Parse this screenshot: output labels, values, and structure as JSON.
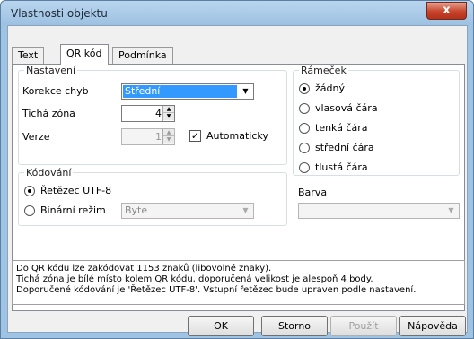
{
  "window": {
    "title": "Vlastnosti objektu",
    "close_glyph": "x"
  },
  "tabs": [
    {
      "label": "Text"
    },
    {
      "label": "QR kód"
    },
    {
      "label": "Podmínka"
    }
  ],
  "active_tab": 1,
  "settings": {
    "group_label": "Nastavení",
    "error_correction_label": "Korekce chyb",
    "error_correction_value": "Střední",
    "quiet_zone_label": "Tichá zóna",
    "quiet_zone_value": "4",
    "version_label": "Verze",
    "version_value": "1",
    "auto_label": "Automaticky",
    "auto_checked": "✓"
  },
  "encoding": {
    "group_label": "Kódování",
    "utf8_label": "Řetězec UTF-8",
    "binary_label": "Binární režim",
    "binary_select_value": "Byte"
  },
  "frame": {
    "group_label": "Rámeček",
    "options": [
      "žádný",
      "vlasová čára",
      "tenká čára",
      "střední čára",
      "tlustá čára"
    ],
    "selected": 0,
    "color_label": "Barva",
    "color_value": ""
  },
  "info_lines": [
    "Do QR kódu lze zakódovat 1153 znaků (libovolné znaky).",
    "Tichá zóna je bílé místo kolem QR kódu, doporučená velikost je alespoň 4 body.",
    "Doporučené kódování je 'Řetězec UTF-8'. Vstupní řetězec bude upraven podle nastavení."
  ],
  "buttons": {
    "ok": "OK",
    "cancel": "Storno",
    "apply": "Použít",
    "help": "Nápověda"
  },
  "icons": {
    "dropdown": "chevron-down-icon",
    "spin_up": "spin-up-icon",
    "spin_down": "spin-down-icon"
  }
}
